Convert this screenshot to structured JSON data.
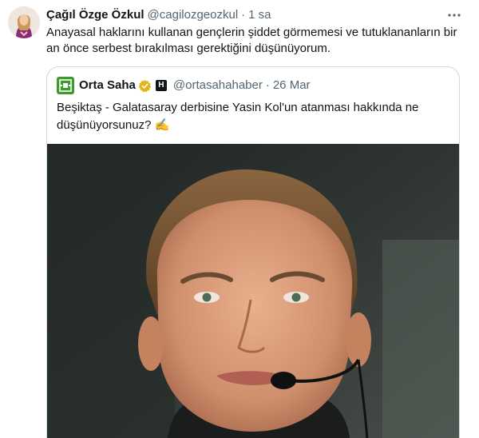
{
  "tweet": {
    "author_name": "Çağıl Özge Özkul",
    "author_handle": "@cagilozgeozkul",
    "separator": "·",
    "timestamp": "1 sa",
    "text": "Anayasal haklarını kullanan gençlerin şiddet görmemesi ve tutuklananların bir an önce serbest bırakılması gerektiğini düşünüyorum.",
    "more_icon": "more-horizontal-icon"
  },
  "quoted_tweet": {
    "author_name": "Orta Saha",
    "verified_icon": "gold-verified-badge-icon",
    "affiliation_badge": "H",
    "author_handle": "@ortasahahaber",
    "separator": "·",
    "timestamp": "26 Mar",
    "text": "Beşiktaş - Galatasaray derbisine Yasin Kol'un atanması hakkında ne düşünüyorsunuz? ✍️",
    "media_description_icon": "photo-icon"
  },
  "colors": {
    "text_primary": "#0f1419",
    "text_secondary": "#536471",
    "border": "#cfd9de",
    "verified_gold": "#e2b719",
    "brand_green": "#3d9b2a"
  }
}
